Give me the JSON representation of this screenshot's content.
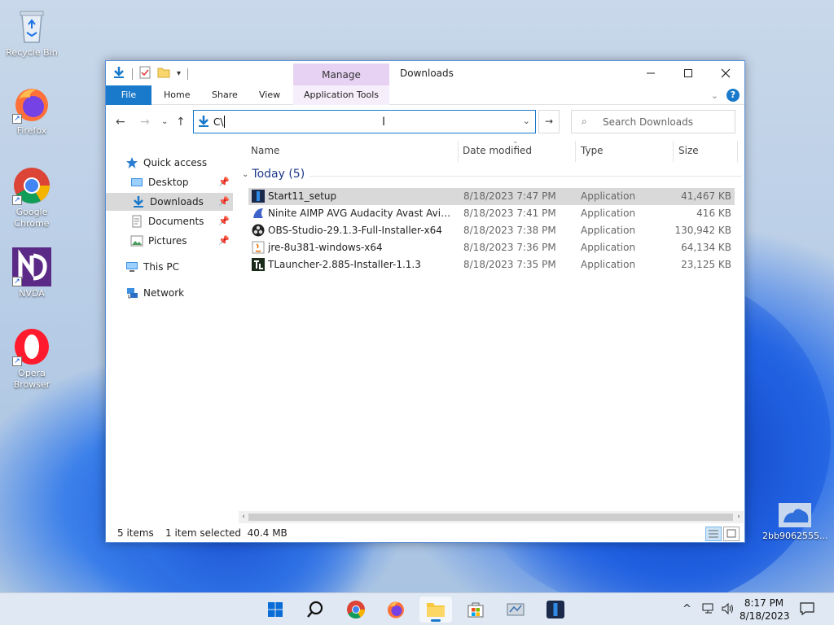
{
  "desktop": {
    "icons": [
      {
        "label": "Recycle Bin"
      },
      {
        "label": "Firefox"
      },
      {
        "label": "Google Chrome"
      },
      {
        "label": "NVDA"
      },
      {
        "label": "Opera Browser"
      },
      {
        "label": "2bb9062555..."
      }
    ]
  },
  "window": {
    "title": "Downloads",
    "manage_tab": "Manage",
    "tabs": {
      "file": "File",
      "home": "Home",
      "share": "Share",
      "view": "View",
      "app_tools": "Application Tools"
    },
    "address_value": "C\\",
    "search_placeholder": "Search Downloads",
    "nav": {
      "quick_access": "Quick access",
      "desktop": "Desktop",
      "downloads": "Downloads",
      "documents": "Documents",
      "pictures": "Pictures",
      "this_pc": "This PC",
      "network": "Network"
    },
    "columns": {
      "name": "Name",
      "date": "Date modified",
      "type": "Type",
      "size": "Size"
    },
    "group": "Today (5)",
    "files": [
      {
        "name": "Start11_setup",
        "date": "8/18/2023 7:47 PM",
        "type": "Application",
        "size": "41,467 KB",
        "selected": true
      },
      {
        "name": "Ninite AIMP AVG Audacity Avast Avira Bl...",
        "date": "8/18/2023 7:41 PM",
        "type": "Application",
        "size": "416 KB"
      },
      {
        "name": "OBS-Studio-29.1.3-Full-Installer-x64",
        "date": "8/18/2023 7:38 PM",
        "type": "Application",
        "size": "130,942 KB"
      },
      {
        "name": "jre-8u381-windows-x64",
        "date": "8/18/2023 7:36 PM",
        "type": "Application",
        "size": "64,134 KB"
      },
      {
        "name": "TLauncher-2.885-Installer-1.1.3",
        "date": "8/18/2023 7:35 PM",
        "type": "Application",
        "size": "23,125 KB"
      }
    ],
    "status": {
      "items": "5 items",
      "selection": "1 item selected  40.4 MB"
    }
  },
  "taskbar": {
    "time": "8:17 PM",
    "date": "8/18/2023"
  },
  "colors": {
    "accent": "#1979ca",
    "manage": "#e8d2f4",
    "selection": "#d9d9d9"
  }
}
